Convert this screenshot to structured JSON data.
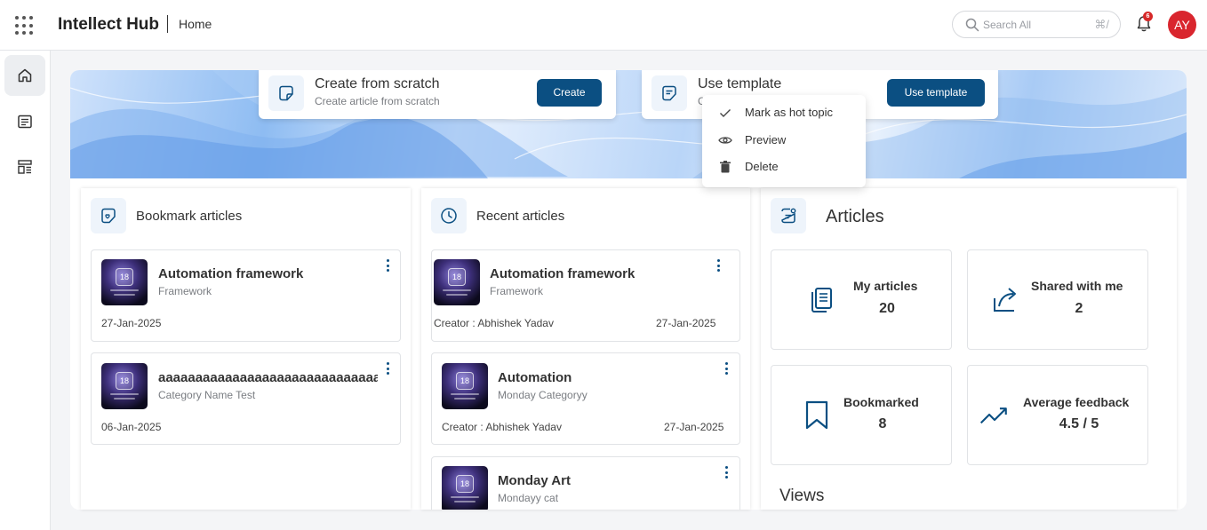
{
  "header": {
    "app_title": "Intellect Hub",
    "breadcrumb": "Home",
    "search_placeholder": "Search All",
    "search_shortcut": "⌘/",
    "notification_count": "6",
    "avatar_initials": "AY"
  },
  "sidebar": {
    "items": [
      {
        "icon": "home-icon",
        "active": true
      },
      {
        "icon": "list-icon",
        "active": false
      },
      {
        "icon": "dashboard-icon",
        "active": false
      }
    ]
  },
  "actions": {
    "create": {
      "title": "Create from scratch",
      "subtitle": "Create article from scratch",
      "button": "Create"
    },
    "template": {
      "title": "Use template",
      "subtitle": "C",
      "button": "Use template"
    }
  },
  "context_menu": {
    "items": [
      "Mark as hot topic",
      "Preview",
      "Delete"
    ]
  },
  "bookmarks": {
    "title": "Bookmark articles",
    "items": [
      {
        "title": "Automation framework",
        "category": "Framework",
        "date": "27-Jan-2025"
      },
      {
        "title": "aaaaaaaaaaaaaaaaaaaaaaaaaaaaaaaa",
        "category": "Category Name Test",
        "date": "06-Jan-2025"
      }
    ]
  },
  "recent": {
    "title": "Recent articles",
    "items": [
      {
        "title": "Automation framework",
        "category": "Framework",
        "creator": "Creator : Abhishek Yadav",
        "date": "27-Jan-2025"
      },
      {
        "title": "Automation",
        "category": "Monday Categoryy",
        "creator": "Creator : Abhishek Yadav",
        "date": "27-Jan-2025"
      },
      {
        "title": "Monday Art",
        "category": "Mondayy cat",
        "creator": "",
        "date": ""
      }
    ]
  },
  "articles": {
    "title": "Articles",
    "stats": [
      {
        "label": "My articles",
        "value": "20",
        "icon": "documents-icon"
      },
      {
        "label": "Shared with me",
        "value": "2",
        "icon": "share-icon"
      },
      {
        "label": "Bookmarked",
        "value": "8",
        "icon": "bookmark-icon"
      },
      {
        "label": "Average feedback",
        "value": "4.5 / 5",
        "icon": "trending-up-icon"
      }
    ],
    "views_label": "Views"
  },
  "thumbnail_text": "18",
  "colors": {
    "primary": "#0b4f82",
    "avatar": "#d9262e",
    "badge": "#d62828"
  }
}
